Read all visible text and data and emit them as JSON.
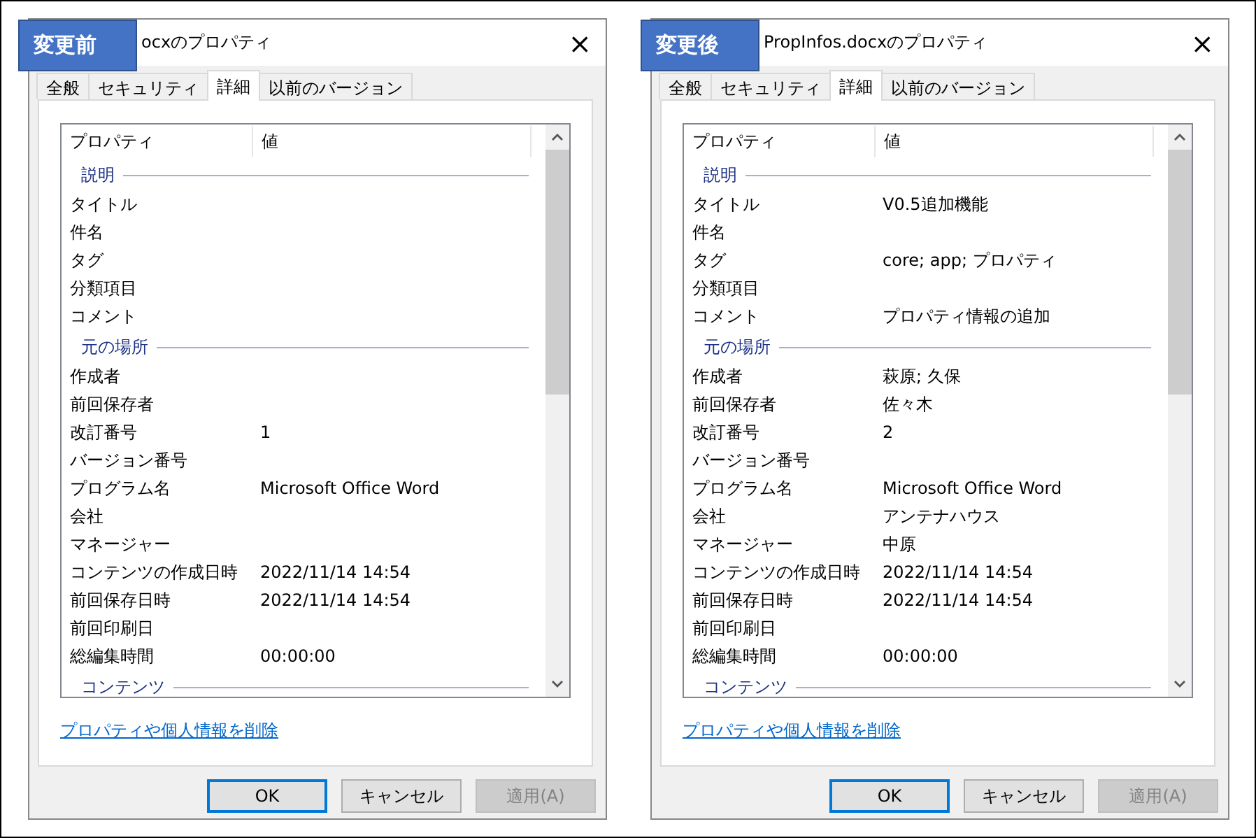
{
  "dialogs": [
    {
      "badge": "変更前",
      "title": "ocxのプロパティ",
      "close": "×",
      "tabs": [
        {
          "label": "全般",
          "selected": false
        },
        {
          "label": "セキュリティ",
          "selected": false
        },
        {
          "label": "詳細",
          "selected": true
        },
        {
          "label": "以前のバージョン",
          "selected": false
        }
      ],
      "columns": [
        "プロパティ",
        "値"
      ],
      "rows": [
        {
          "kind": "section",
          "name": "説明"
        },
        {
          "kind": "prop",
          "name": "タイトル"
        },
        {
          "kind": "prop",
          "name": "件名"
        },
        {
          "kind": "prop",
          "name": "タグ"
        },
        {
          "kind": "prop",
          "name": "分類項目"
        },
        {
          "kind": "prop",
          "name": "コメント"
        },
        {
          "kind": "section",
          "name": "元の場所"
        },
        {
          "kind": "prop",
          "name": "作成者"
        },
        {
          "kind": "prop",
          "name": "前回保存者"
        },
        {
          "kind": "prop",
          "name": "改訂番号",
          "value": "1"
        },
        {
          "kind": "prop",
          "name": "バージョン番号"
        },
        {
          "kind": "prop",
          "name": "プログラム名",
          "value": "Microsoft Office Word"
        },
        {
          "kind": "prop",
          "name": "会社"
        },
        {
          "kind": "prop",
          "name": "マネージャー"
        },
        {
          "kind": "prop",
          "name": "コンテンツの作成日時",
          "value": "2022/11/14 14:54"
        },
        {
          "kind": "prop",
          "name": "前回保存日時",
          "value": "2022/11/14 14:54"
        },
        {
          "kind": "prop",
          "name": "前回印刷日"
        },
        {
          "kind": "prop",
          "name": "総編集時間",
          "value": "00:00:00"
        },
        {
          "kind": "section",
          "name": "コンテンツ"
        }
      ],
      "link": "プロパティや個人情報を削除",
      "buttons": [
        {
          "label": "OK",
          "default": true,
          "disabled": false
        },
        {
          "label": "キャンセル",
          "default": false,
          "disabled": false
        },
        {
          "label": "適用(A)",
          "default": false,
          "disabled": true
        }
      ]
    },
    {
      "badge": "変更後",
      "title": "PropInfos.docxのプロパティ",
      "close": "×",
      "tabs": [
        {
          "label": "全般",
          "selected": false
        },
        {
          "label": "セキュリティ",
          "selected": false
        },
        {
          "label": "詳細",
          "selected": true
        },
        {
          "label": "以前のバージョン",
          "selected": false
        }
      ],
      "columns": [
        "プロパティ",
        "値"
      ],
      "rows": [
        {
          "kind": "section",
          "name": "説明"
        },
        {
          "kind": "prop",
          "name": "タイトル",
          "value": "V0.5追加機能"
        },
        {
          "kind": "prop",
          "name": "件名"
        },
        {
          "kind": "prop",
          "name": "タグ",
          "value": "core; app; プロパティ"
        },
        {
          "kind": "prop",
          "name": "分類項目"
        },
        {
          "kind": "prop",
          "name": "コメント",
          "value": "プロパティ情報の追加"
        },
        {
          "kind": "section",
          "name": "元の場所"
        },
        {
          "kind": "prop",
          "name": "作成者",
          "value": "萩原; 久保"
        },
        {
          "kind": "prop",
          "name": "前回保存者",
          "value": "佐々木"
        },
        {
          "kind": "prop",
          "name": "改訂番号",
          "value": "2"
        },
        {
          "kind": "prop",
          "name": "バージョン番号"
        },
        {
          "kind": "prop",
          "name": "プログラム名",
          "value": "Microsoft Office Word"
        },
        {
          "kind": "prop",
          "name": "会社",
          "value": "アンテナハウス"
        },
        {
          "kind": "prop",
          "name": "マネージャー",
          "value": "中原"
        },
        {
          "kind": "prop",
          "name": "コンテンツの作成日時",
          "value": "2022/11/14 14:54"
        },
        {
          "kind": "prop",
          "name": "前回保存日時",
          "value": "2022/11/14 14:54"
        },
        {
          "kind": "prop",
          "name": "前回印刷日"
        },
        {
          "kind": "prop",
          "name": "総編集時間",
          "value": "00:00:00"
        },
        {
          "kind": "section",
          "name": "コンテンツ"
        }
      ],
      "link": "プロパティや個人情報を削除",
      "buttons": [
        {
          "label": "OK",
          "default": true,
          "disabled": false
        },
        {
          "label": "キャンセル",
          "default": false,
          "disabled": false
        },
        {
          "label": "適用(A)",
          "default": false,
          "disabled": true
        }
      ]
    }
  ]
}
